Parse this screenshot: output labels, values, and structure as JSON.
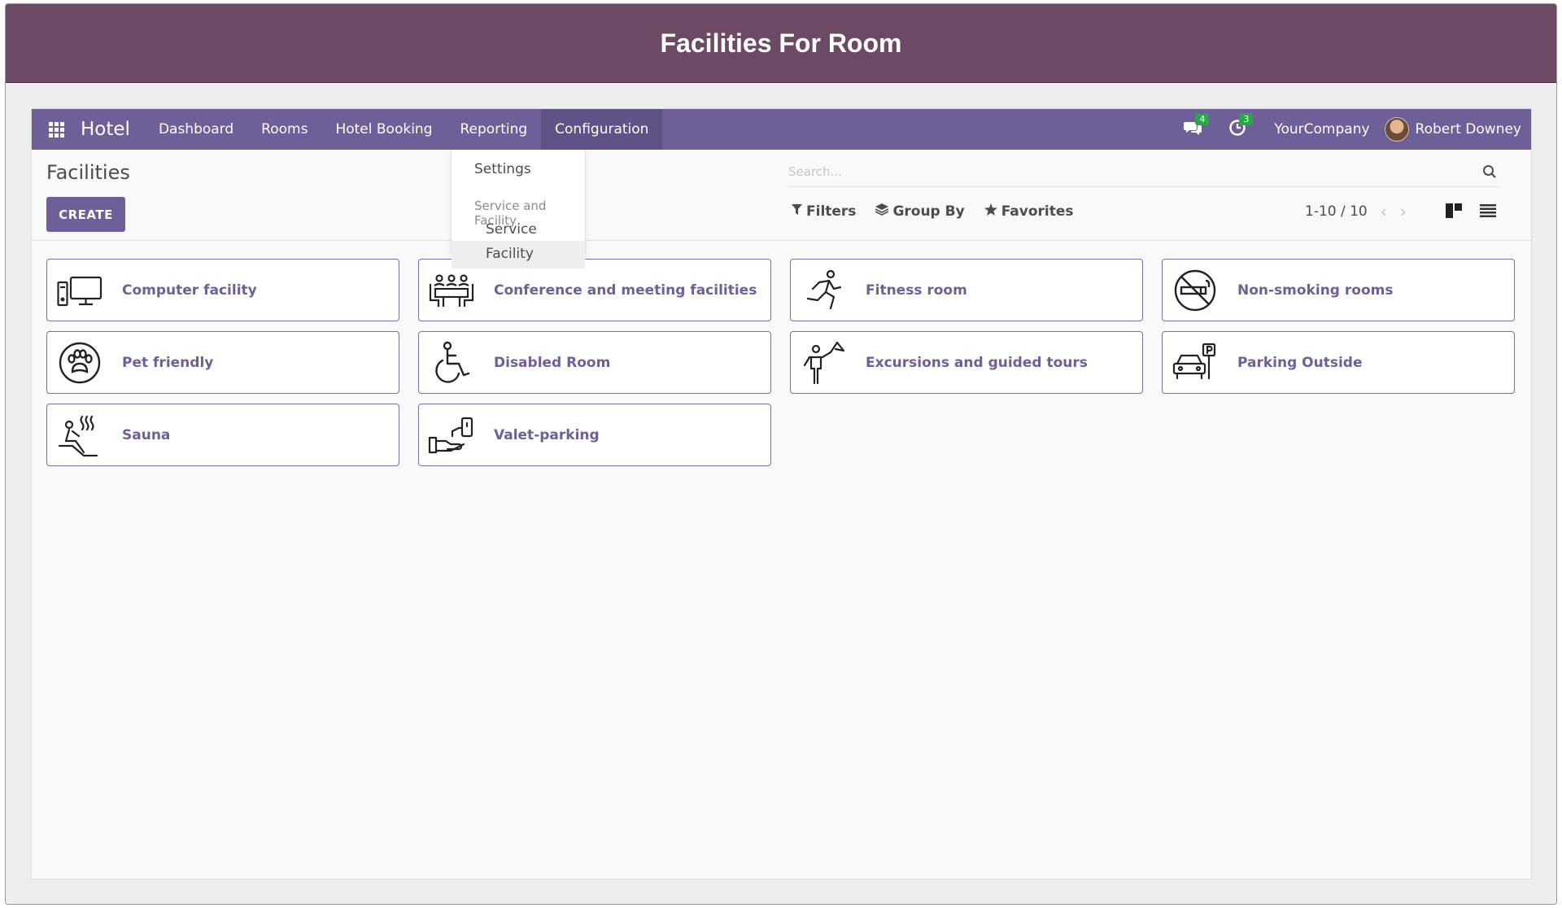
{
  "banner": {
    "title": "Facilities For Room"
  },
  "navbar": {
    "brand": "Hotel",
    "menu": [
      "Dashboard",
      "Rooms",
      "Hotel Booking",
      "Reporting",
      "Configuration"
    ],
    "active_menu": "Configuration",
    "messages_count": "4",
    "activities_count": "3",
    "company": "YourCompany",
    "user": "Robert Downey"
  },
  "dropdown": {
    "settings": "Settings",
    "section_header": "Service and Facility",
    "service": "Service",
    "facility": "Facility"
  },
  "control_panel": {
    "title": "Facilities",
    "create_label": "CREATE",
    "search_placeholder": "Search...",
    "filters_label": "Filters",
    "group_by_label": "Group By",
    "favorites_label": "Favorites",
    "pager": "1-10 / 10"
  },
  "facilities": [
    {
      "name": "Computer facility",
      "icon": "computer-icon"
    },
    {
      "name": "Conference and meeting facilities",
      "icon": "meeting-icon"
    },
    {
      "name": "Fitness room",
      "icon": "running-person-icon"
    },
    {
      "name": "Non-smoking rooms",
      "icon": "no-smoking-icon"
    },
    {
      "name": "Pet friendly",
      "icon": "paw-icon"
    },
    {
      "name": "Disabled Room",
      "icon": "wheelchair-icon"
    },
    {
      "name": "Excursions and guided tours",
      "icon": "tour-guide-flag-icon"
    },
    {
      "name": "Parking Outside",
      "icon": "parking-car-icon"
    },
    {
      "name": "Sauna",
      "icon": "sauna-icon"
    },
    {
      "name": "Valet-parking",
      "icon": "valet-key-hand-icon"
    }
  ],
  "colors": {
    "banner": "#6c4a63",
    "navbar": "#6e5f98",
    "accent_text": "#6e5f98",
    "badge": "#28a745"
  }
}
